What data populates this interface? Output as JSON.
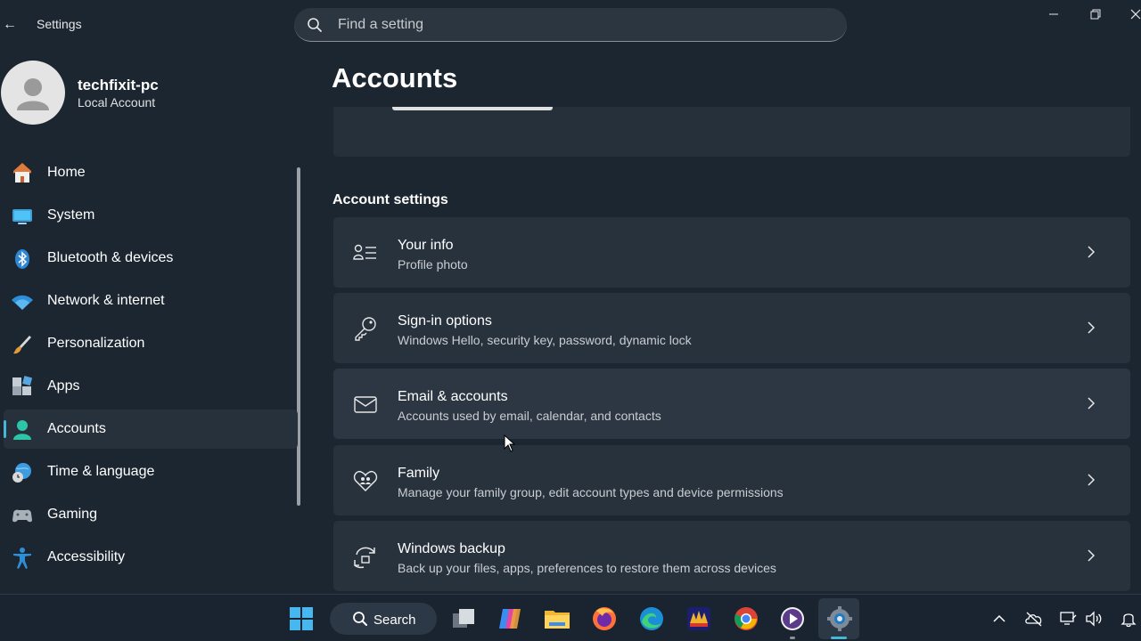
{
  "window": {
    "back_glyph": "←",
    "title": "Settings",
    "controls": [
      "minimize-icon",
      "restore-icon",
      "close-icon"
    ]
  },
  "search": {
    "placeholder": "Find a setting"
  },
  "user": {
    "name": "techfixit-pc",
    "account_type": "Local Account"
  },
  "sidebar": {
    "selected": "Accounts",
    "items": [
      {
        "label": "Home",
        "icon": "home-icon"
      },
      {
        "label": "System",
        "icon": "monitor-icon"
      },
      {
        "label": "Bluetooth & devices",
        "icon": "bluetooth-icon"
      },
      {
        "label": "Network & internet",
        "icon": "wifi-icon"
      },
      {
        "label": "Personalization",
        "icon": "brush-icon"
      },
      {
        "label": "Apps",
        "icon": "apps-icon"
      },
      {
        "label": "Accounts",
        "icon": "person-icon"
      },
      {
        "label": "Time & language",
        "icon": "globe-clock-icon"
      },
      {
        "label": "Gaming",
        "icon": "gamepad-icon"
      },
      {
        "label": "Accessibility",
        "icon": "accessibility-icon"
      }
    ]
  },
  "main": {
    "page_title": "Accounts",
    "section_title": "Account settings",
    "cards": [
      {
        "title": "Your info",
        "subtitle": "Profile photo",
        "icon": "person-card-icon"
      },
      {
        "title": "Sign-in options",
        "subtitle": "Windows Hello, security key, password, dynamic lock",
        "icon": "key-icon"
      },
      {
        "title": "Email & accounts",
        "subtitle": "Accounts used by email, calendar, and contacts",
        "icon": "mail-icon"
      },
      {
        "title": "Family",
        "subtitle": "Manage your family group, edit account types and device permissions",
        "icon": "family-heart-icon"
      },
      {
        "title": "Windows backup",
        "subtitle": "Back up your files, apps, preferences to restore them across devices",
        "icon": "backup-icon"
      }
    ]
  },
  "taskbar": {
    "search_label": "Search",
    "apps": [
      "start-icon",
      "task-view-icon",
      "copilot-icon",
      "file-explorer-icon",
      "firefox-icon",
      "edge-icon",
      "winamp-icon",
      "chrome-icon",
      "media-player-icon",
      "settings-icon"
    ],
    "tray": [
      "chevron-up-icon",
      "onedrive-icon",
      "network-icon",
      "volume-icon",
      "notification-icon"
    ]
  },
  "colors": {
    "accent": "#47b7d9",
    "background": "#1c2631",
    "card": "#28323d",
    "taskbar": "#1a2330"
  }
}
